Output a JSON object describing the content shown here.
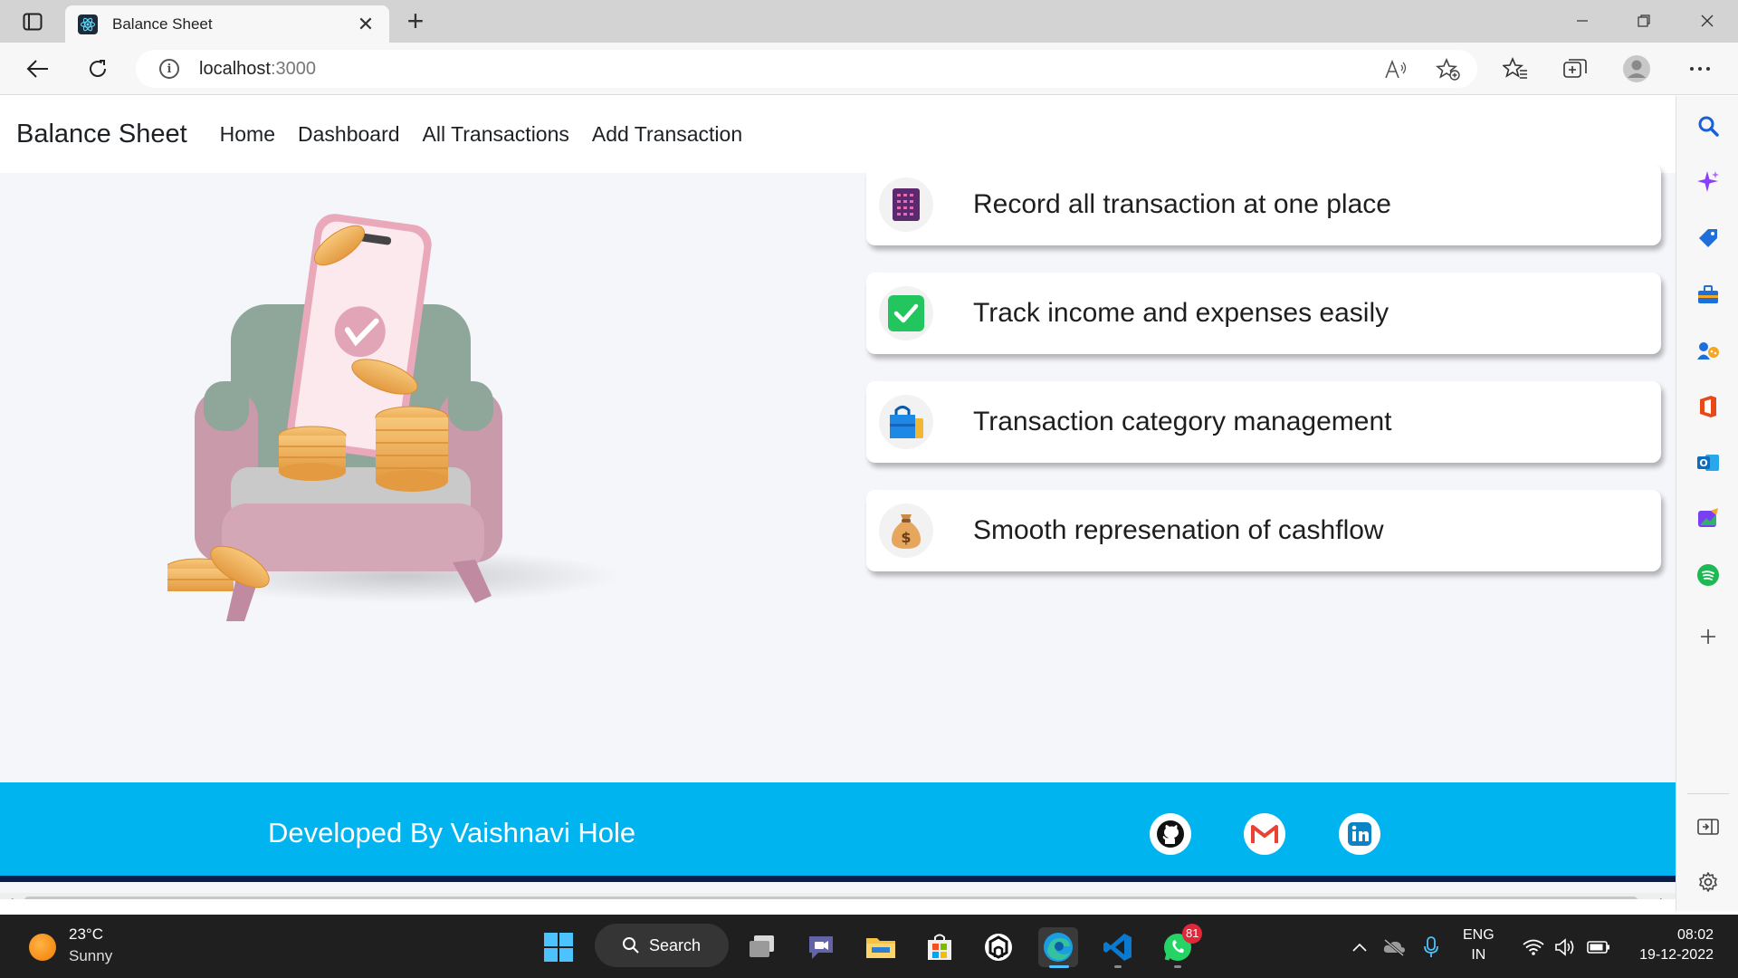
{
  "browser": {
    "tab_title": "Balance Sheet",
    "close_tab_glyph": "✕",
    "new_tab_glyph": "+",
    "url_host": "localhost",
    "url_port": ":3000",
    "info_glyph": "i"
  },
  "navbar": {
    "brand": "Balance Sheet",
    "links": [
      "Home",
      "Dashboard",
      "All Transactions",
      "Add Transaction"
    ]
  },
  "features": [
    {
      "text": "Record all transaction at one place",
      "icon": "ledger-book-icon"
    },
    {
      "text": "Track income and expenses easily",
      "icon": "check-mark-icon"
    },
    {
      "text": "Transaction category management",
      "icon": "shopping-bags-icon"
    },
    {
      "text": "Smooth represenation of cashflow",
      "icon": "money-bag-icon"
    }
  ],
  "footer": {
    "credit": "Developed By Vaishnavi Hole",
    "socials": [
      "github-icon",
      "gmail-icon",
      "linkedin-icon"
    ]
  },
  "taskbar": {
    "weather_temp": "23°C",
    "weather_condition": "Sunny",
    "search_label": "Search",
    "whatsapp_badge": "81",
    "lang_top": "ENG",
    "lang_bottom": "IN",
    "time": "08:02",
    "date": "19-12-2022"
  },
  "colors": {
    "footer_bg": "#00b4f0",
    "footer_border": "#0b1e4b",
    "page_bg": "#f5f6fa"
  }
}
